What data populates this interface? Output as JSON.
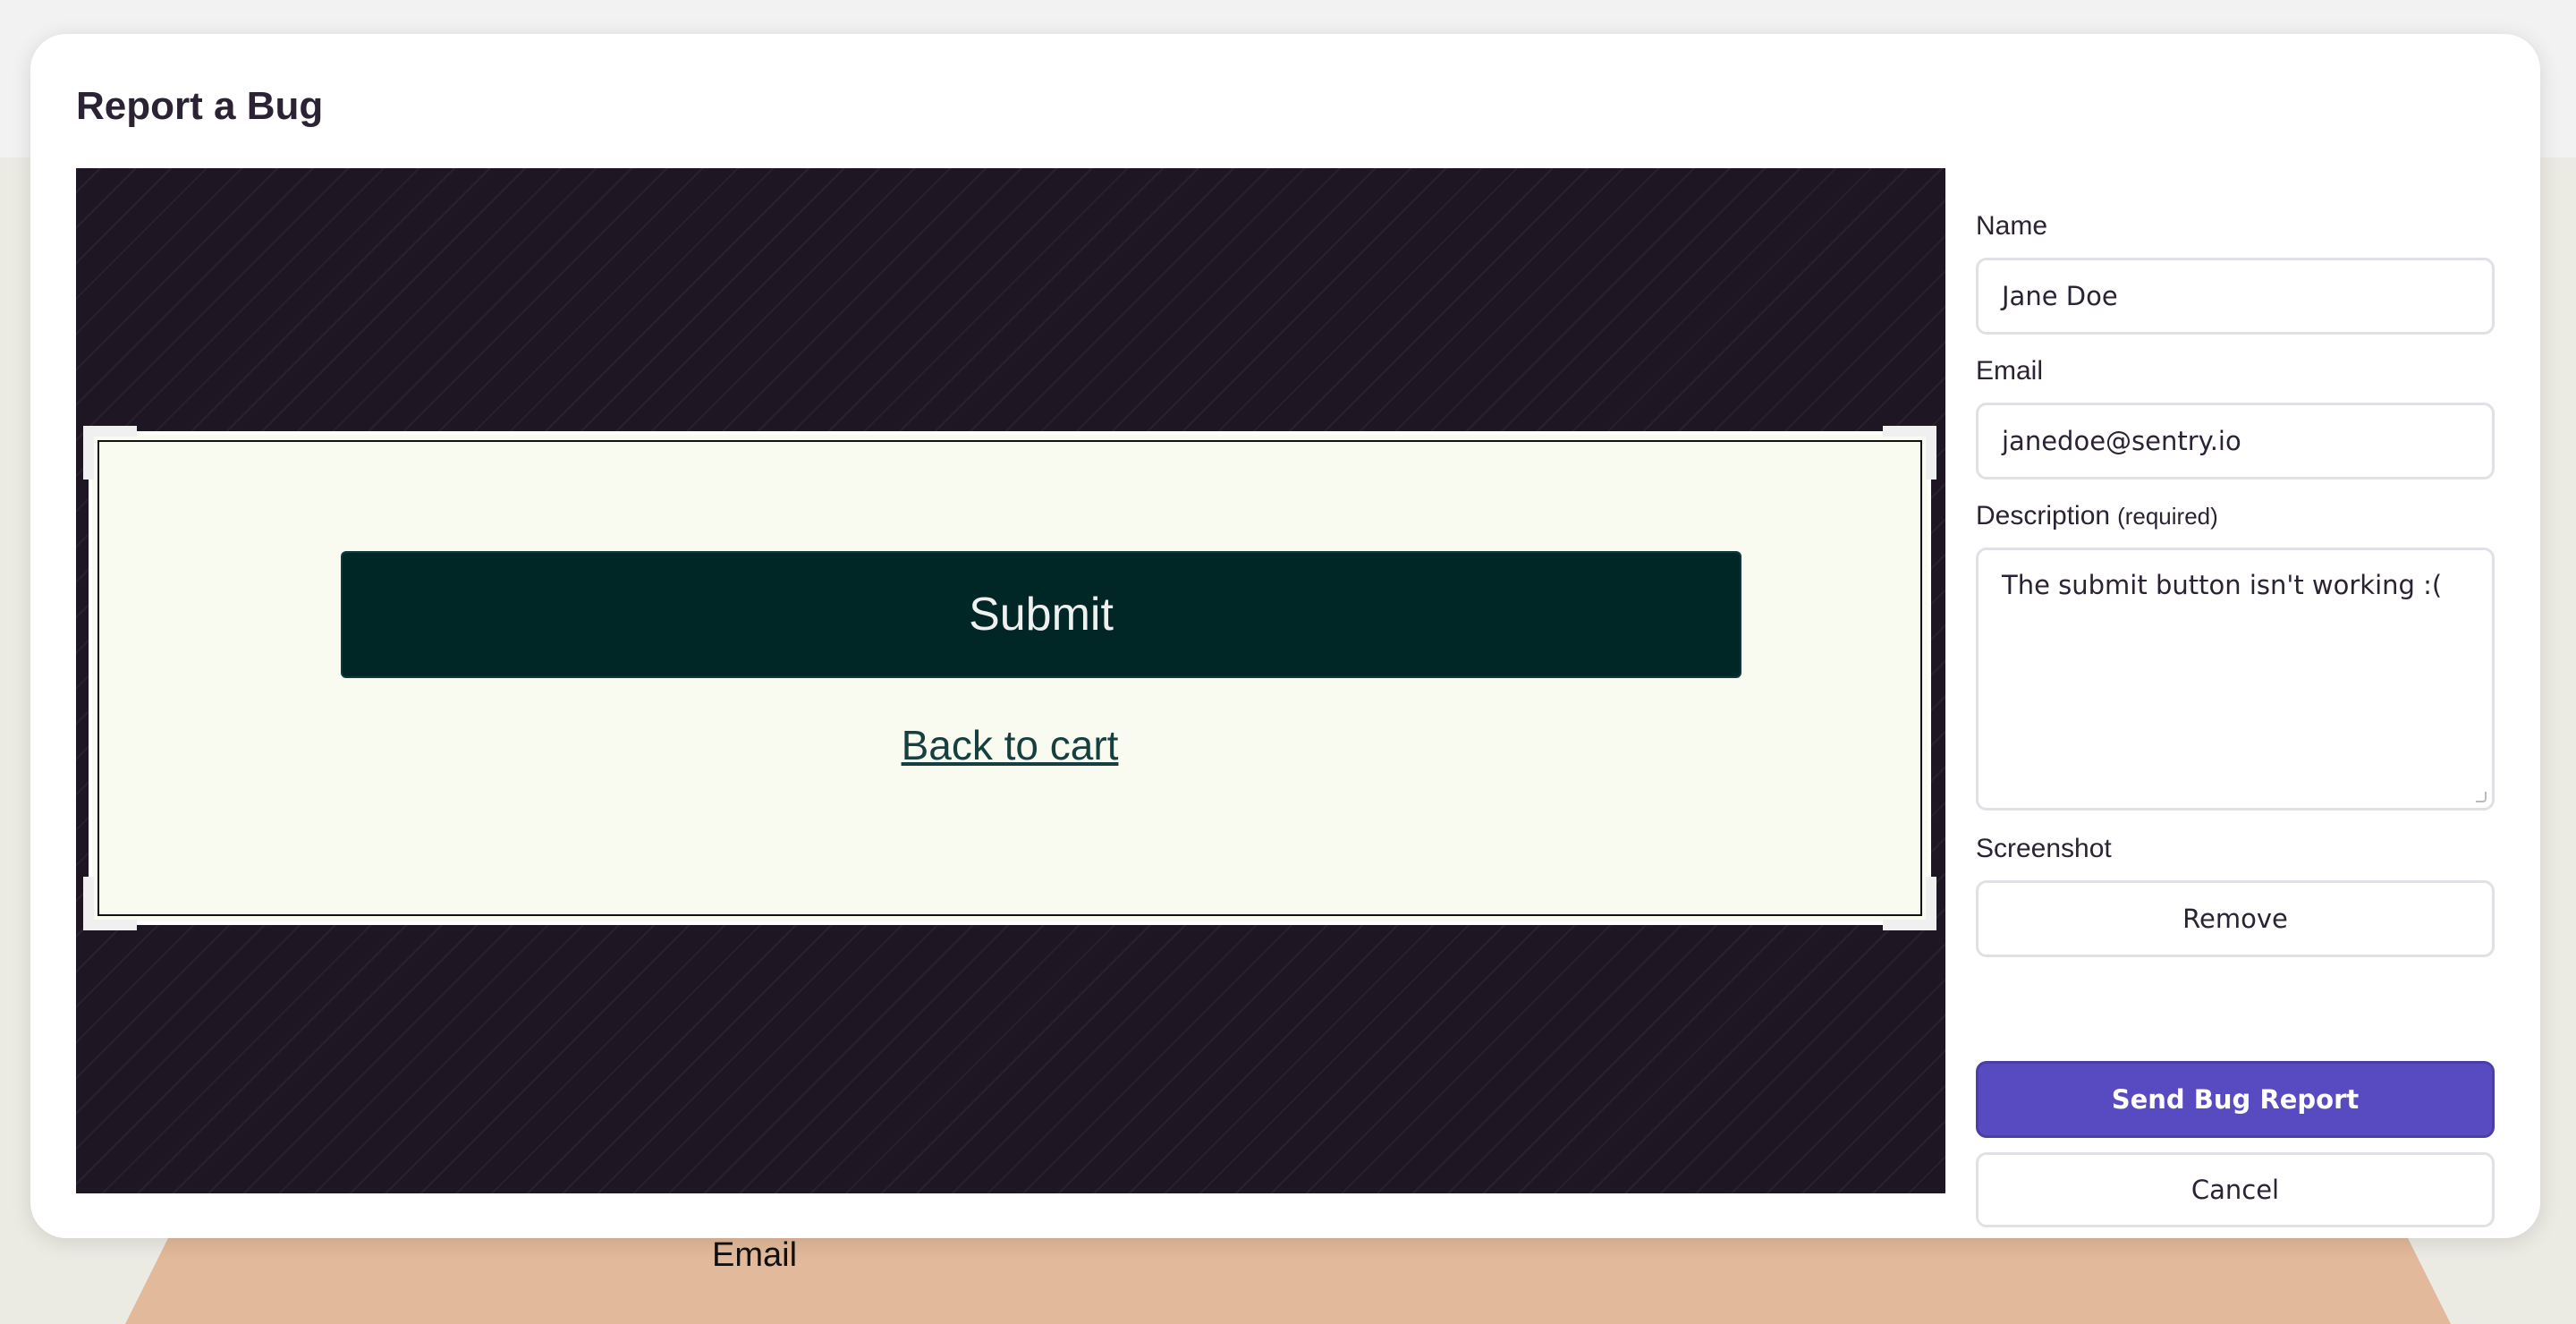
{
  "background_page": {
    "email_label": "Email"
  },
  "dialog": {
    "title": "Report a Bug"
  },
  "screenshot_preview": {
    "submit_label": "Submit",
    "back_link": "Back to cart"
  },
  "form": {
    "name": {
      "label": "Name",
      "value": "Jane Doe"
    },
    "email": {
      "label": "Email",
      "value": "janedoe@sentry.io"
    },
    "description": {
      "label": "Description",
      "required_label": "(required)",
      "value": "The submit button isn't working :("
    },
    "screenshot": {
      "label": "Screenshot",
      "remove_label": "Remove"
    },
    "send_label": "Send Bug Report",
    "cancel_label": "Cancel"
  },
  "colors": {
    "primary": "#584ac0",
    "editor_background": "#1e1623",
    "preview_button": "#012626",
    "preview_background": "#f9faf0"
  }
}
